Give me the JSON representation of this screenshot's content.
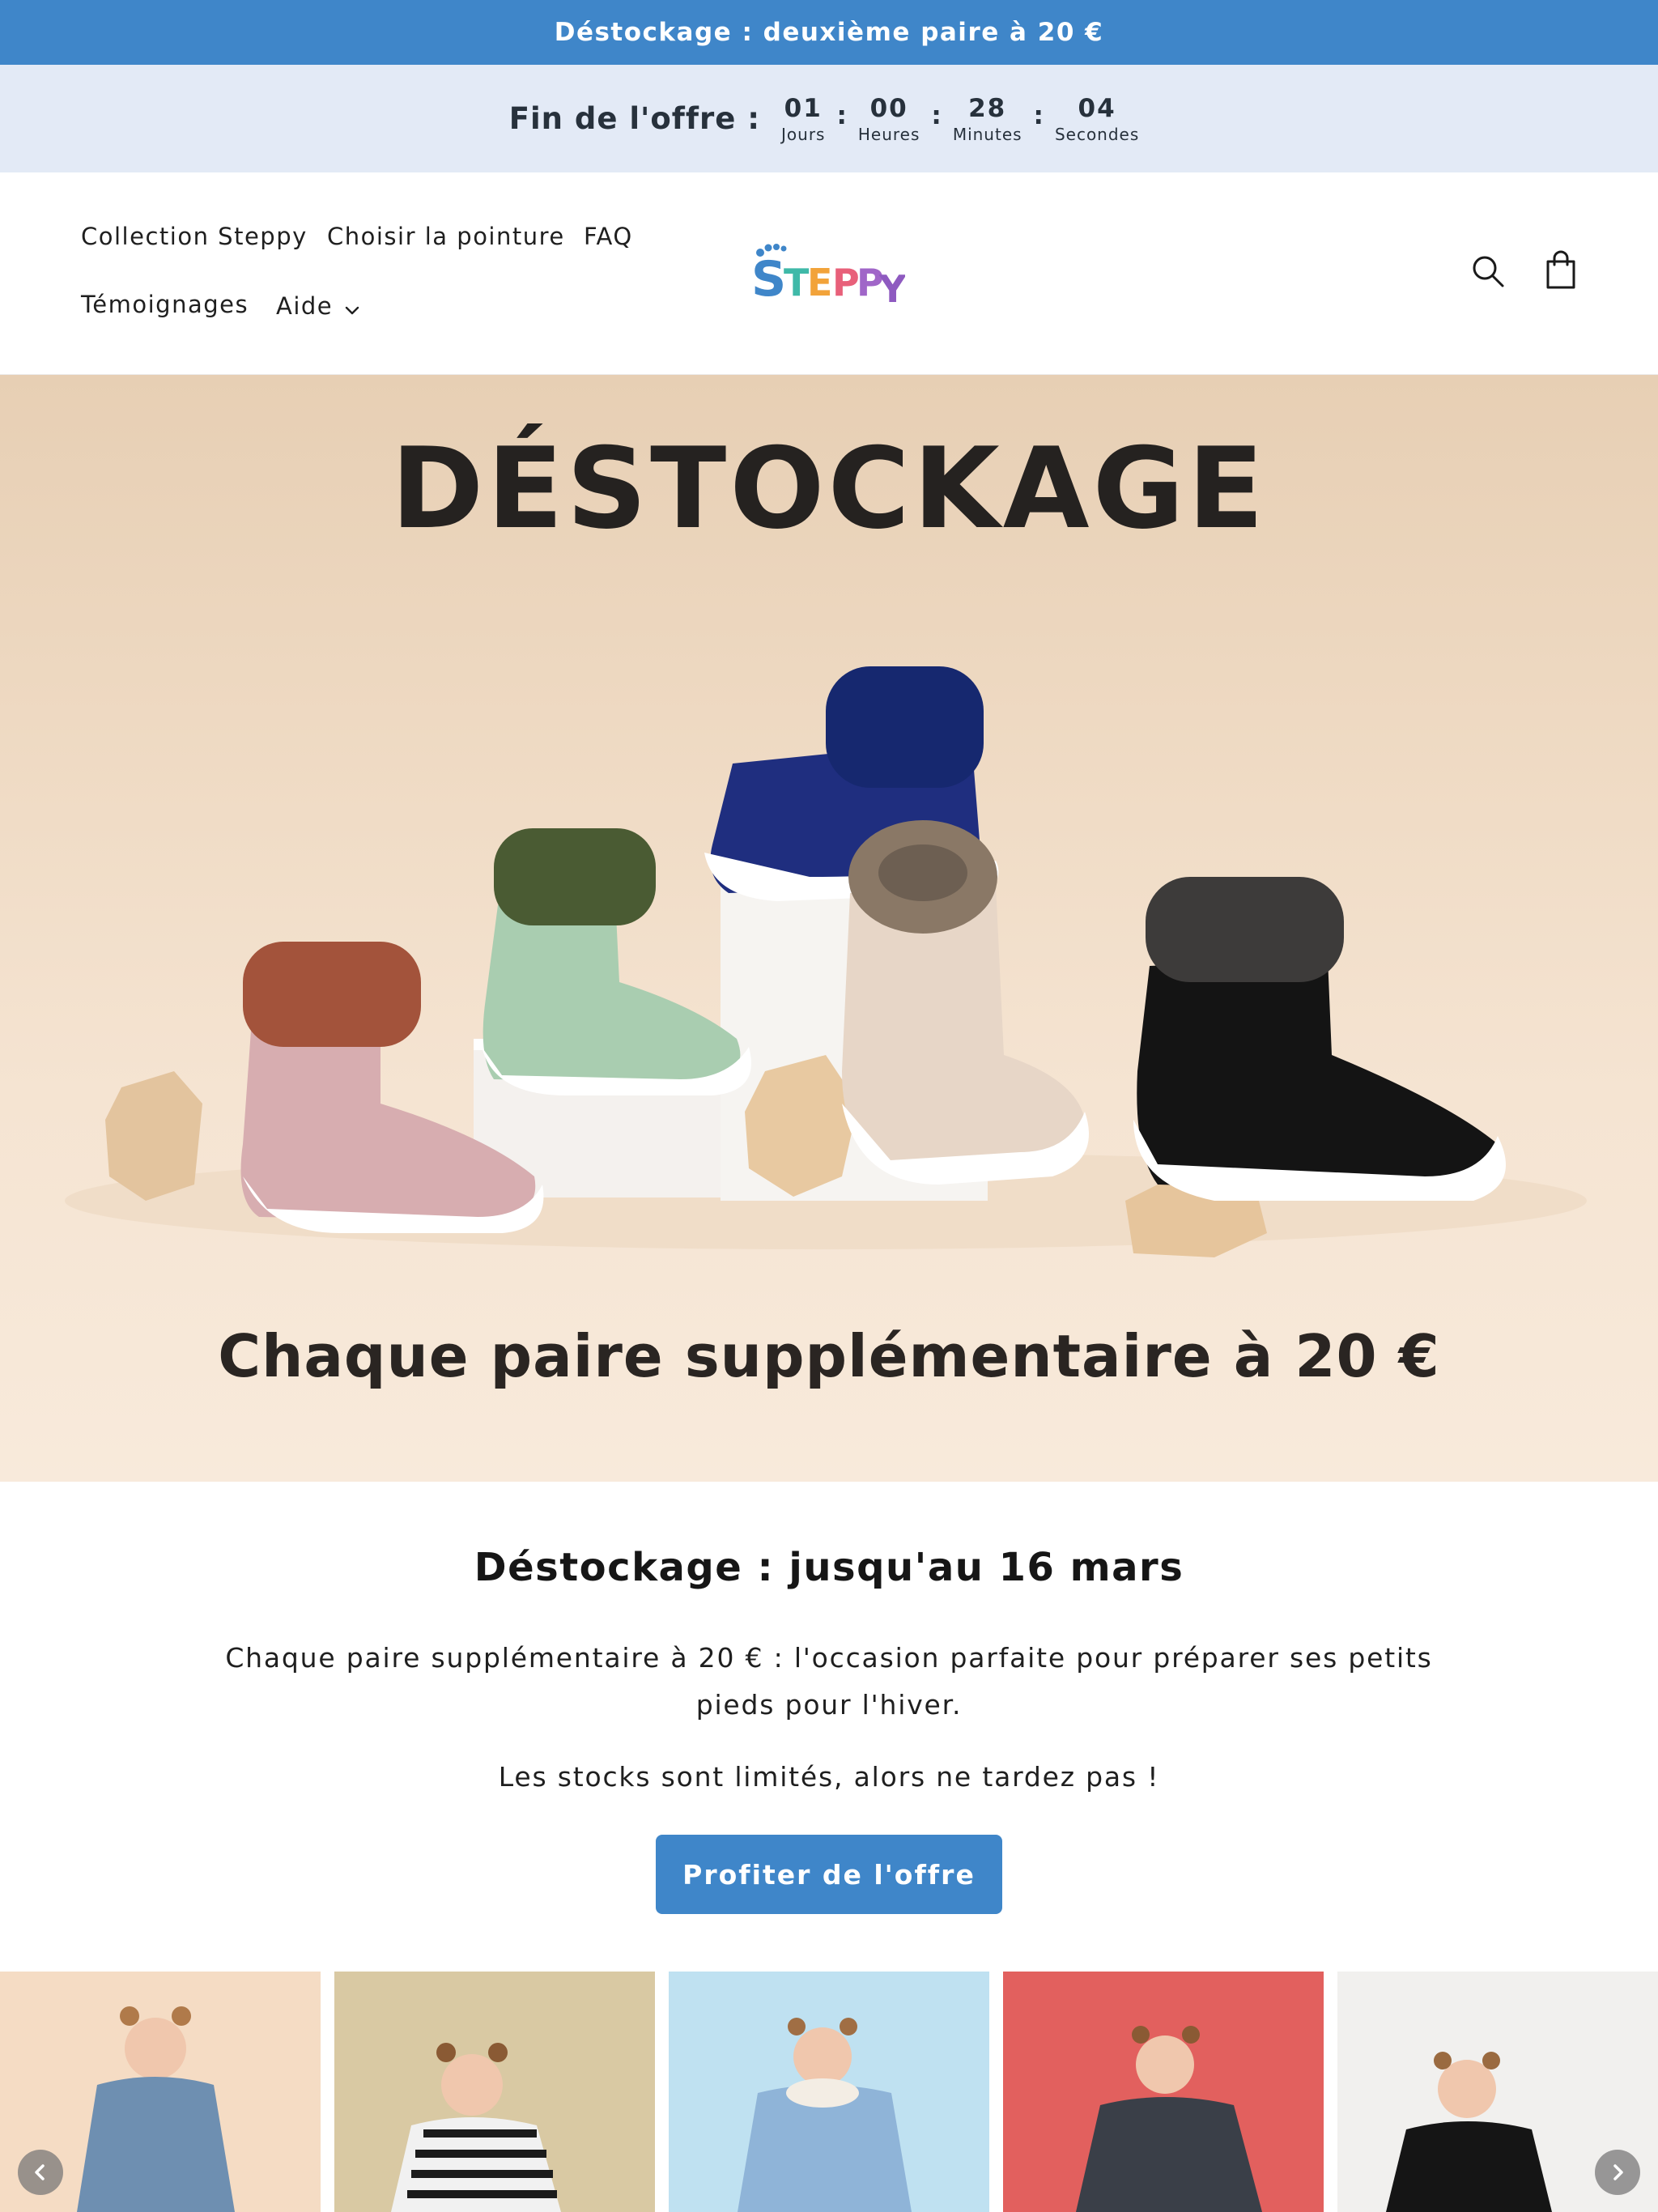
{
  "announcement": {
    "text": "Déstockage : deuxième paire à 20 €"
  },
  "countdown": {
    "label": "Fin de l'offre :",
    "separator": ":",
    "units": [
      {
        "value": "01",
        "caption": "Jours"
      },
      {
        "value": "00",
        "caption": "Heures"
      },
      {
        "value": "28",
        "caption": "Minutes"
      },
      {
        "value": "04",
        "caption": "Secondes"
      }
    ]
  },
  "header": {
    "nav": [
      {
        "label": "Collection Steppy"
      },
      {
        "label": "Choisir la pointure"
      },
      {
        "label": "FAQ"
      },
      {
        "label": "Témoignages"
      },
      {
        "label": "Aide"
      }
    ],
    "logo_text": "STEPPY",
    "logo_colors": [
      "#3f86c9",
      "#3fb9a8",
      "#f2a33a",
      "#e8607a",
      "#a066c8",
      "#8e5ac0"
    ],
    "icons": [
      "search-icon",
      "cart-icon"
    ]
  },
  "hero": {
    "title": "DÉSTOCKAGE",
    "subtitle": "Chaque paire supplémentaire à 20 €",
    "shoe_colors": [
      {
        "cuff": "#a3533b",
        "sock": "#d7adb0"
      },
      {
        "cuff": "#4a5b33",
        "sock": "#a9cdb0"
      },
      {
        "cuff": "#16286f",
        "sock": "#1f2e7f"
      },
      {
        "cuff": "#8a7866",
        "sock": "#e7d6c7"
      },
      {
        "cuff": "#3d3b3a",
        "sock": "#141414"
      }
    ]
  },
  "content": {
    "title": "Déstockage : jusqu'au 16 mars",
    "paragraph1": "Chaque paire supplémentaire à 20 € : l'occasion parfaite pour préparer ses petits pieds pour l'hiver.",
    "paragraph2": "Les stocks sont limités, alors ne tardez pas !",
    "cta_label": "Profiter de l'offre"
  },
  "carousel": {
    "slides": [
      {
        "background": "#f5dcc4",
        "outfit": "#6e8fb1"
      },
      {
        "background": "#d9c9a3",
        "outfit": "#f1f1f1"
      },
      {
        "background": "#bfe1f1",
        "outfit": "#8fb4d8"
      },
      {
        "background": "#e2605e",
        "outfit": "#3a3f48"
      },
      {
        "background": "#f1f0ee",
        "outfit": "#151515"
      }
    ],
    "prev_icon": "chevron-left-icon",
    "next_icon": "chevron-right-icon"
  }
}
